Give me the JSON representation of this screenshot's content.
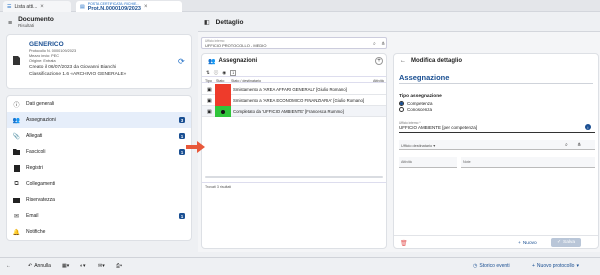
{
  "tabs": [
    {
      "label": "Lista atti..."
    },
    {
      "line1": "POSTA CERTIFICATA: RICHIE...",
      "line2": "Prot.N.0000109/2023"
    }
  ],
  "left": {
    "header_title": "Documento",
    "header_subtitle": "Risultati",
    "doc": {
      "title": "GENERICO",
      "protocollo": "Protocollo N. 0000109/2023",
      "mezzo": "Mezzo invio: PEC",
      "origine": "Origine: Entrata",
      "creato": "Creato il 06/07/2023 da Giovanni Bianchi",
      "classificazione": "Classificazione 1.6 «ARCHIVIO GENERALE»"
    },
    "menu": [
      {
        "label": "Dati generali",
        "icon": "info-icon",
        "badge": ""
      },
      {
        "label": "Assegnazioni",
        "icon": "users-icon",
        "badge": "3"
      },
      {
        "label": "Allegati",
        "icon": "paperclip-icon",
        "badge": "1"
      },
      {
        "label": "Fascicoli",
        "icon": "folder-icon",
        "badge": "1"
      },
      {
        "label": "Registri",
        "icon": "book-icon",
        "badge": ""
      },
      {
        "label": "Collegamenti",
        "icon": "link-icon",
        "badge": ""
      },
      {
        "label": "Riservatezza",
        "icon": "lock-icon",
        "badge": ""
      },
      {
        "label": "Email",
        "icon": "mail-icon",
        "badge": "1"
      },
      {
        "label": "Notifiche",
        "icon": "bell-icon",
        "badge": ""
      }
    ]
  },
  "right": {
    "header_title": "Dettaglio",
    "ufficio_label": "Ufficio interno",
    "ufficio_value": "UFFICIO PROTOCOLLO - MEDIO",
    "assegnazioni": {
      "title": "Assegnazioni",
      "count_badge": "1",
      "columns": [
        "Tipo",
        "Stato",
        "Stato / destinatario",
        "Attività"
      ],
      "rows": [
        {
          "status": "red",
          "text": "Smistamento a 'AREA AFFARI GENERALI' [Giulio Romano]"
        },
        {
          "status": "red",
          "text": "Smistamento a 'AREA ECONOMICO FINANZIARIA' [Giulio Romano]"
        },
        {
          "status": "green",
          "text": "Completato da 'UFFICIO AMBIENTE' [Francesca Rummo]"
        }
      ],
      "footer": "Trovati 3 risultati"
    },
    "modifica": {
      "title": "Modifica dettaglio",
      "section": "Assegnazione",
      "tipo_label": "Tipo assegnazione",
      "options": [
        "Competenza",
        "Conoscenza"
      ],
      "selected": "Competenza",
      "ufficio_interno_label": "Ufficio interno *",
      "ufficio_interno_value": "UFFICIO AMBIENTE [per competenza]",
      "ufficio_dest_label": "Ufficio destinatario ▾",
      "attivita_label": "Attività",
      "note_label": "Note",
      "nuovo_label": "Nuovo",
      "salva_label": "Salva"
    }
  },
  "bottom": {
    "annulla": "Annulla",
    "storico": "Storico eventi",
    "nuovo_protocollo": "Nuovo protocollo"
  },
  "colors": {
    "accent": "#1a4f92",
    "red_status": "#ee3b2b",
    "green_status": "#2fc53a",
    "arrow": "#e8583a"
  }
}
